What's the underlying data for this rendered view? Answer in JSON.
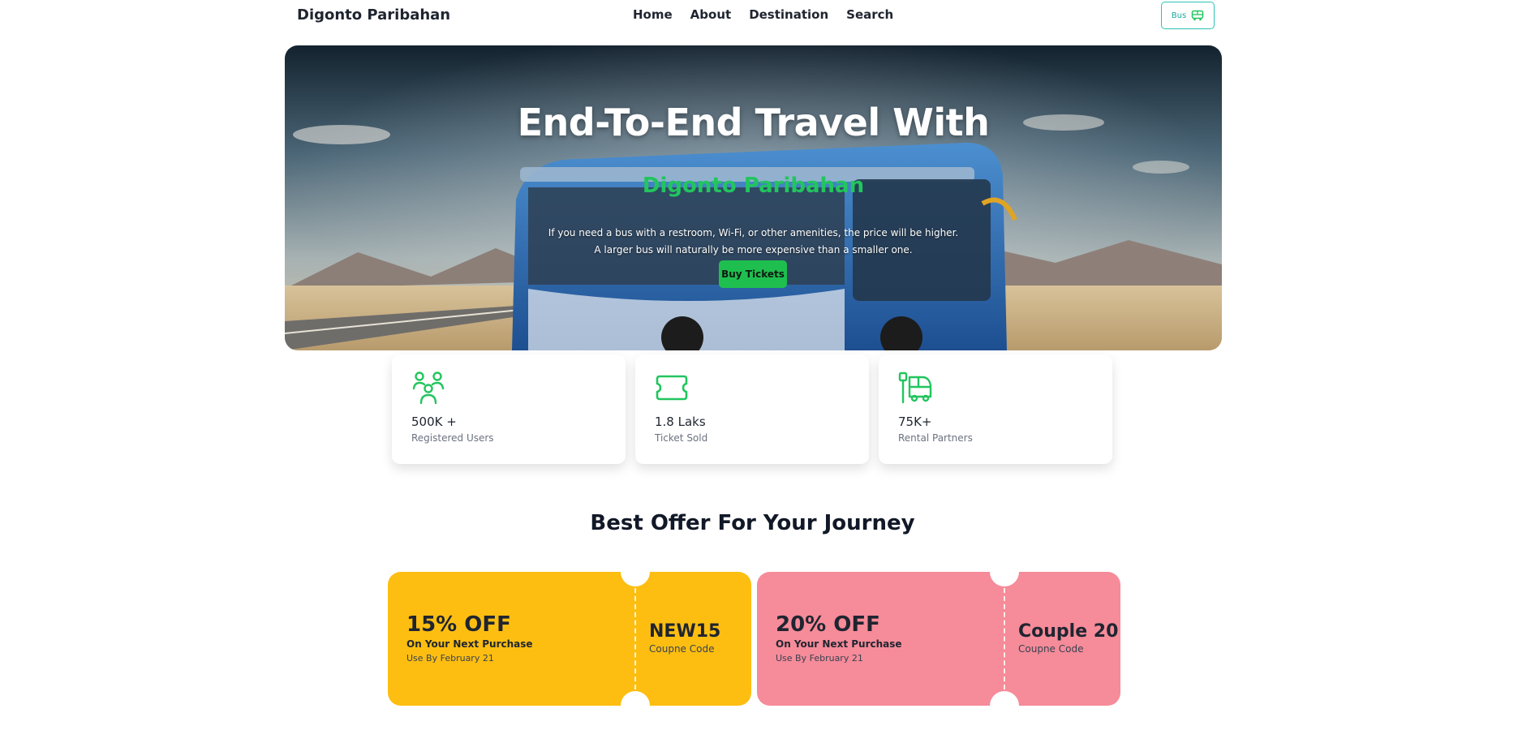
{
  "nav": {
    "brand": "Digonto Paribahan",
    "links": [
      "Home",
      "About",
      "Destination",
      "Search"
    ],
    "bus_button": "Bus"
  },
  "hero": {
    "title": "End-To-End Travel With",
    "subtitle": "Digonto Paribahan",
    "desc_line1": "If you need a bus with a restroom, Wi-Fi, or other amenities, the price will be higher.",
    "desc_line2": "A larger bus will naturally be more expensive than a smaller one.",
    "cta": "Buy Tickets"
  },
  "stats": [
    {
      "icon": "users-icon",
      "value": "500K +",
      "label": "Registered Users"
    },
    {
      "icon": "ticket-icon",
      "value": "1.8 Laks",
      "label": "Ticket Sold"
    },
    {
      "icon": "bus-stop-icon",
      "value": "75K+",
      "label": "Rental Partners"
    }
  ],
  "offers": {
    "title": "Best Offer For Your Journey",
    "coupons": [
      {
        "discount": "15% OFF",
        "note": "On Your Next Purchase",
        "date": "Use By February 21",
        "code": "NEW15",
        "code_label": "Coupne Code",
        "color": "#fdbe11"
      },
      {
        "discount": "20% OFF",
        "note": "On Your Next Purchase",
        "date": "Use By February 21",
        "code": "Couple 20",
        "code_label": "Coupne Code",
        "color": "#f68b99"
      }
    ]
  },
  "colors": {
    "accent": "#22c55e",
    "teal": "#2dc3b4",
    "yellow": "#fdbe11",
    "pink": "#f68b99"
  }
}
